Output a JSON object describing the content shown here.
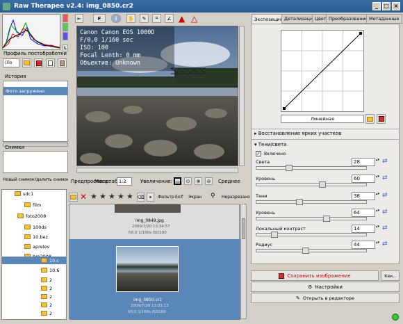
{
  "window": {
    "title": "Raw Therapee v2.4: img_0850.cr2"
  },
  "left": {
    "profile_label": "Профиль постобработки",
    "profile_value": "(По",
    "history_label": "История",
    "history_item": "Фото загружено",
    "snapshots_label": "Снимки",
    "new_snapshot": "Новый снимок",
    "delete_snapshot": "Удалить снимок"
  },
  "toolbar": {
    "letter_f": "F",
    "letter_l": "L"
  },
  "image": {
    "overlay": [
      "Canon Canon EOS 1000D",
      "F/0,0 1/160 sec",
      "ISO: 100",
      "Focal Lenth: 0 mm",
      "Объектив: Unknown"
    ]
  },
  "preview_bar": {
    "preview_label": "Предпросмотр:",
    "scale_label": "Масштаб:",
    "scale_value": "1:2",
    "zoom_label": "Увеличение:",
    "quality": "Среднее"
  },
  "tree": {
    "items": [
      "sdc1",
      "film",
      "foto2008",
      "100ds",
      "10.bez",
      "aprelev",
      "bm2008",
      "10.c",
      "10.6",
      "2",
      "2",
      "2",
      "2",
      "2",
      "2"
    ]
  },
  "filmstrip": {
    "filter_label": "Фильтр",
    "extra_label": "Ехіf",
    "type_label": "Экран",
    "undelete_label": "Неразрезано",
    "thumbs": [
      {
        "name": "img_0849.jpg",
        "date": "2009/7/20 13:34:57",
        "exif": "f/0,0 1/160s ISO100"
      },
      {
        "name": "img_0850.cr2",
        "date": "2009/7/20 13:33:13",
        "exif": "f/0,0 1/160s ISO100"
      }
    ]
  },
  "right": {
    "tabs": [
      "Экспозиция",
      "Детализация",
      "Цвет",
      "Преобразования",
      "Метаданные"
    ],
    "curve_type": "Линейная",
    "section_highlight": "Восстановление ярких участков",
    "section_shadows": "Тени/света",
    "enabled_label": "Включено",
    "sliders": [
      {
        "label": "Света",
        "value": "28",
        "pos": 0.28
      },
      {
        "label": "Уровень",
        "value": "60",
        "pos": 0.6
      },
      {
        "label": "Тени",
        "value": "38",
        "pos": 0.38
      },
      {
        "label": "Уровень",
        "value": "64",
        "pos": 0.64
      },
      {
        "label": "Локальный контраст",
        "value": "14",
        "pos": 0.14
      },
      {
        "label": "Радиус",
        "value": "44",
        "pos": 0.44
      }
    ],
    "save_image": "Сохранить изображение",
    "settings": "Настройки",
    "open_editor": "Открыть в редакторе",
    "queue_label": "Кек.."
  },
  "colors": {
    "accent": "#2a5a90",
    "selection": "#5b86b8",
    "save_red": "#c00000"
  }
}
